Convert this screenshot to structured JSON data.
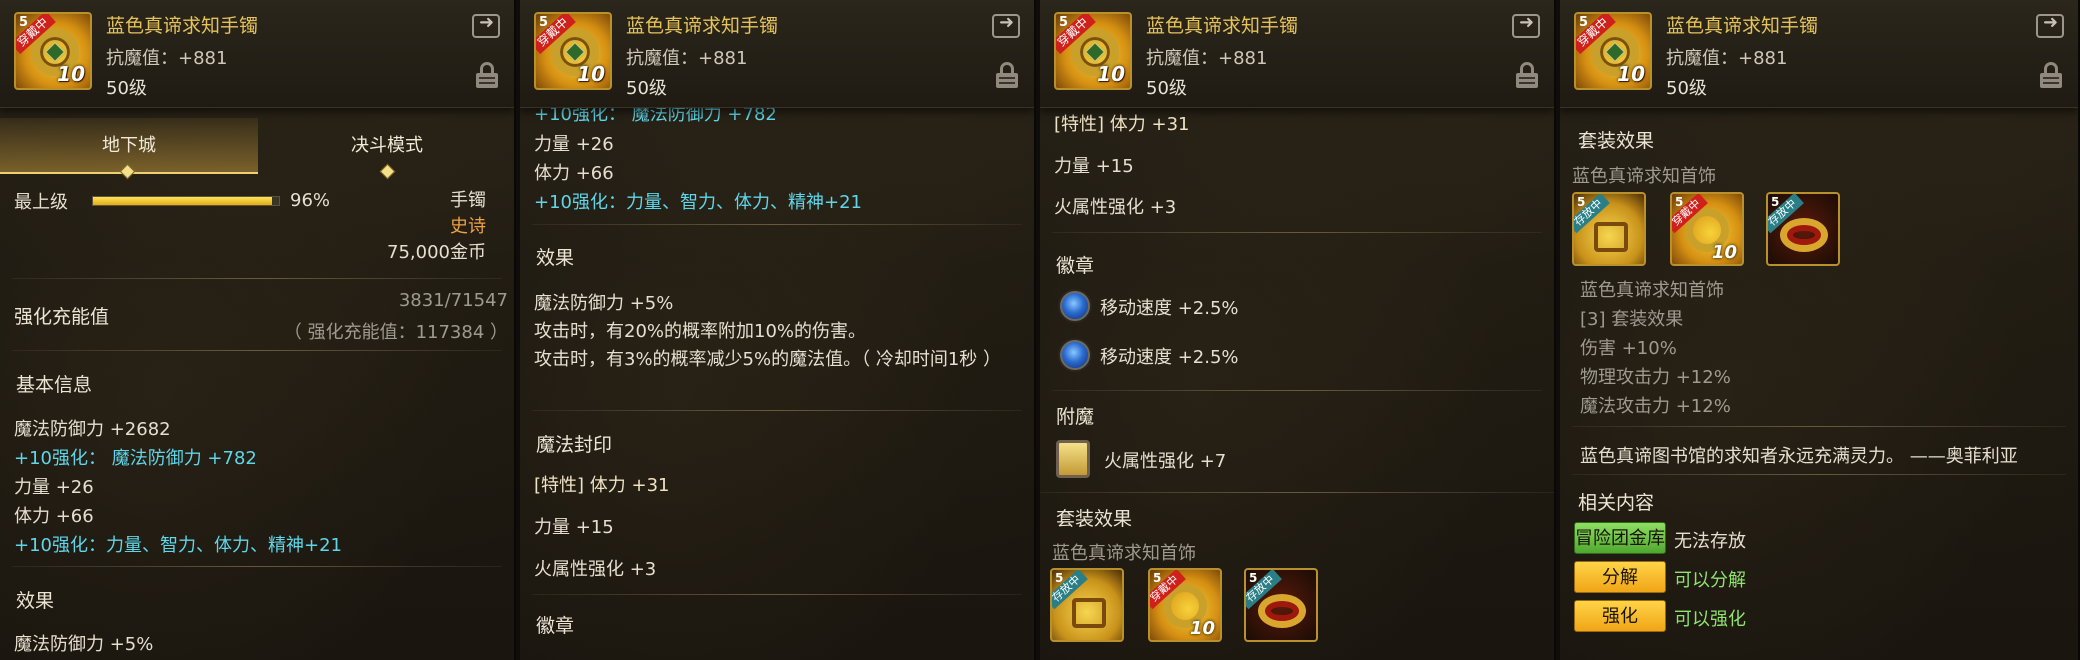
{
  "item": {
    "title": "蓝色真谛求知手镯",
    "stat": "抗魔值：+881",
    "level": "50级",
    "icon_level": "5",
    "icon_tag": "穿戴中",
    "icon_num": "10"
  },
  "icons": {
    "share": "share-icon",
    "lock": "lock-icon"
  },
  "panel1": {
    "tabs": [
      "地下城",
      "决斗模式"
    ],
    "grade_label": "最上级",
    "grade_percent_text": "96%",
    "grade_fraction": 0.96,
    "type": "手镯",
    "rarity": "史诗",
    "price": "75,000金币",
    "charge_label": "强化充能值",
    "charge_value": "3831/71547",
    "charge_total": "（ 强化充能值：117384 ）",
    "basic_title": "基本信息",
    "basic_lines": [
      "魔法防御力 +2682",
      "+10强化：  魔法防御力 +782",
      "力量 +26",
      "体力 +66",
      "+10强化：力量、智力、体力、精神+21"
    ],
    "effect_title": "效果",
    "effect_partial": "魔法防御力 +5%"
  },
  "panel2": {
    "top_partial": "+10强化：  魔法防御力 +782",
    "stat_lines": [
      "力量 +26",
      "体力 +66",
      "+10强化：力量、智力、体力、精神+21"
    ],
    "effect_title": "效果",
    "effect_lines": [
      "魔法防御力 +5%",
      "攻击时，有20%的概率附加10%的伤害。",
      "攻击时，有3%的概率减少5%的魔法值。（ 冷却时间1秒 ）"
    ],
    "seal_title": "魔法封印",
    "seal_lines": [
      "[特性] 体力 +31",
      "力量 +15",
      "火属性强化 +3"
    ],
    "emblem_title": "徽章"
  },
  "panel3": {
    "seal_lines": [
      "[特性] 体力 +31",
      "力量 +15",
      "火属性强化 +3"
    ],
    "emblem_title": "徽章",
    "emblems": [
      "移动速度 +2.5%",
      "移动速度 +2.5%"
    ],
    "enchant_title": "附魔",
    "enchant": "火属性强化 +7",
    "set_title": "套装效果",
    "set_name": "蓝色真谛求知首饰",
    "set_icons": [
      {
        "level": "5",
        "tag": "存放中"
      },
      {
        "level": "5",
        "tag": "穿戴中",
        "num": "10"
      },
      {
        "level": "5",
        "tag": "存放中"
      }
    ]
  },
  "panel4": {
    "set_title": "套装效果",
    "set_name": "蓝色真谛求知首饰",
    "set_icons": [
      {
        "level": "5",
        "tag": "存放中"
      },
      {
        "level": "5",
        "tag": "穿戴中",
        "num": "10"
      },
      {
        "level": "5",
        "tag": "存放中"
      }
    ],
    "set_lines": [
      "蓝色真谛求知首饰",
      "[3] 套装效果",
      "伤害 +10%",
      "物理攻击力 +12%",
      "魔法攻击力 +12%"
    ],
    "flavor": "蓝色真谛图书馆的求知者永远充满灵力。 ——奥菲利亚",
    "related_title": "相关内容",
    "related": [
      {
        "button": "冒险团金库",
        "text": "无法存放"
      },
      {
        "button": "分解",
        "text": "可以分解"
      },
      {
        "button": "强化",
        "text": "可以强化"
      }
    ]
  }
}
